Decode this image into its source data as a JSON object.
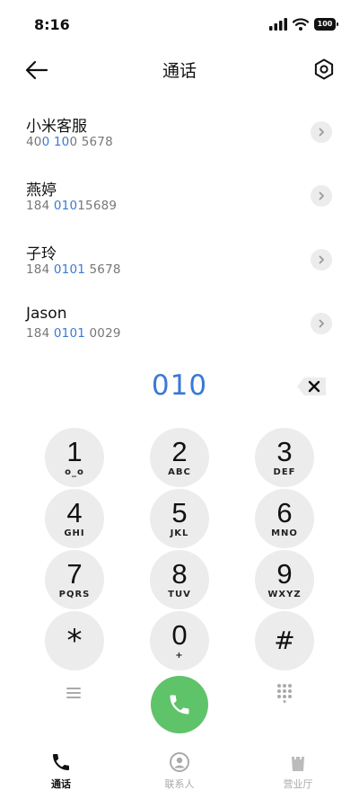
{
  "status_bar": {
    "time": "8:16",
    "battery": "100"
  },
  "header": {
    "title": "通话"
  },
  "contacts": [
    {
      "name": "小米客服",
      "number_pre": "40",
      "number_hl": "0 10",
      "number_post": "0 5678"
    },
    {
      "name": "燕婷",
      "number_pre": "184 ",
      "number_hl": "010",
      "number_post": "15689"
    },
    {
      "name": "子玲",
      "number_pre": "184 ",
      "number_hl": "0101",
      "number_post": " 5678"
    },
    {
      "name": "Jason",
      "number_pre": "184 ",
      "number_hl": "0101",
      "number_post": " 0029"
    }
  ],
  "dialer": {
    "entered_number": "010",
    "keys": [
      {
        "digit": "1",
        "letters": "o_o"
      },
      {
        "digit": "2",
        "letters": "ABC"
      },
      {
        "digit": "3",
        "letters": "DEF"
      },
      {
        "digit": "4",
        "letters": "GHI"
      },
      {
        "digit": "5",
        "letters": "JKL"
      },
      {
        "digit": "6",
        "letters": "MNO"
      },
      {
        "digit": "7",
        "letters": "PQRS"
      },
      {
        "digit": "8",
        "letters": "TUV"
      },
      {
        "digit": "9",
        "letters": "WXYZ"
      },
      {
        "digit": "*",
        "letters": ""
      },
      {
        "digit": "0",
        "letters": "+"
      },
      {
        "digit": "#",
        "letters": ""
      }
    ]
  },
  "bottom_nav": [
    {
      "label": "通话",
      "icon": "phone-icon",
      "active": true
    },
    {
      "label": "联系人",
      "icon": "contacts-icon",
      "active": false
    },
    {
      "label": "营业厅",
      "icon": "store-icon",
      "active": false
    }
  ],
  "colors": {
    "accent": "#3a79d6",
    "call_green": "#5fc36a",
    "key_bg": "#ececec"
  }
}
